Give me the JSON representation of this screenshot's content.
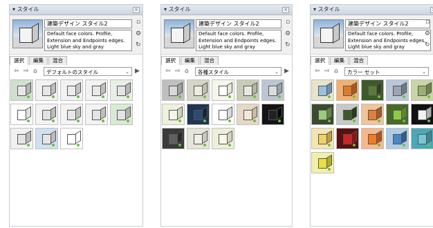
{
  "panels": [
    {
      "title": "スタイル",
      "style_name": "建築デザイン スタイル2",
      "description": "Default face colors. Profile, Extension and Endpoints edges. Light blue sky and gray",
      "tabs": [
        "選択",
        "編集",
        "混合"
      ],
      "dropdown": "デフォルトのスタイル",
      "tiles": [
        {
          "bg": "#cfe0cf",
          "face": "#e8e8e8",
          "side": "#b5b5b5"
        },
        {
          "bg": "#f2f2f2",
          "face": "#e6e6e6",
          "side": "#bdbdbd"
        },
        {
          "bg": "#f2f2f2",
          "face": "#ececec",
          "side": "#c4c4c4"
        },
        {
          "bg": "#f2f2f2",
          "face": "#e9e9e9",
          "side": "#c0c0c0"
        },
        {
          "bg": "#e8efe4",
          "face": "#e4e4e4",
          "side": "#b8b8b8"
        },
        {
          "bg": "#ffffff",
          "face": "#ffffff",
          "side": "#e0e0e0"
        },
        {
          "bg": "#f3f3f3",
          "face": "#e2e2e2",
          "side": "#bcbcbc"
        },
        {
          "bg": "#f3f3f3",
          "face": "#e8e8e8",
          "side": "#c2c2c2"
        },
        {
          "bg": "#f3f3f3",
          "face": "#e5e5e5",
          "side": "#c0c0c0"
        },
        {
          "bg": "#d9ead3",
          "face": "#e3e3e3",
          "side": "#b2b2b2"
        },
        {
          "bg": "#f1f1f1",
          "face": "#e4e4e4",
          "side": "#bdbdbd"
        },
        {
          "bg": "#cfe0f0",
          "face": "#e6e6e6",
          "side": "#bcbcbc"
        },
        {
          "bg": "#ffffff",
          "face": "#ffffff",
          "side": "#ffffff"
        }
      ]
    },
    {
      "title": "スタイル",
      "style_name": "建築デザイン スタイル2",
      "description": "Default face colors. Profile, Extension and Endpoints edges. Light blue sky and gray",
      "tabs": [
        "選択",
        "編集",
        "混合"
      ],
      "dropdown": "各種スタイル",
      "tiles": [
        {
          "bg": "#bfbfbf",
          "face": "#d8d8d8",
          "side": "#a0a0a0"
        },
        {
          "bg": "#d6d6c8",
          "face": "#ecece0",
          "side": "#c0c0b0"
        },
        {
          "bg": "#f6f6ee",
          "face": "#ffffff",
          "side": "#e6e6da"
        },
        {
          "bg": "#c9cbb9",
          "face": "#e8e8dc",
          "side": "#b4b4a4"
        },
        {
          "bg": "#bcc6d2",
          "face": "#dcdcdc",
          "side": "#9aa2aa"
        },
        {
          "bg": "#eef2dc",
          "face": "#f4f4e8",
          "side": "#d0d4bc"
        },
        {
          "bg": "#1f3552",
          "face": "#2d4a70",
          "side": "#16263c"
        },
        {
          "bg": "#ffffff",
          "face": "#ffffff",
          "side": "#d8d8d8"
        },
        {
          "bg": "#e6d8c4",
          "face": "#f2e8d8",
          "side": "#cdbaa0"
        },
        {
          "bg": "#141414",
          "face": "#222222",
          "side": "#0c0c0c"
        },
        {
          "bg": "#3b3b3b",
          "face": "#606060",
          "side": "#2a2a2a"
        },
        {
          "bg": "#e5e5d8",
          "face": "#f0f0e6",
          "side": "#c9c9bb"
        },
        {
          "bg": "#eeeeda",
          "face": "#f7f7ea",
          "side": "#d6d6c2"
        }
      ]
    },
    {
      "title": "スタイル",
      "style_name": "建築デザイン スタイル2",
      "description": "Default face colors. Profile, Extension and Endpoints edges. Light blue sky and gray",
      "tabs": [
        "選択",
        "編集",
        "混合"
      ],
      "dropdown": "カラー セット",
      "tiles": [
        {
          "bg": "#e8e4c8",
          "face": "#9bc0de",
          "side": "#6d92b2"
        },
        {
          "bg": "#f0b070",
          "face": "#e07a2c",
          "side": "#b0581a"
        },
        {
          "bg": "#3f5a2a",
          "face": "#5b7b3a",
          "side": "#2e4420"
        },
        {
          "bg": "#b8c8d8",
          "face": "#9aa6b2",
          "side": "#6e7a86"
        },
        {
          "bg": "#c9d4a8",
          "face": "#9bb070",
          "side": "#70844c"
        },
        {
          "bg": "#3c4a30",
          "face": "#9ccc7a",
          "side": "#5f8a44"
        },
        {
          "bg": "#c8c8c8",
          "face": "#3a5a2a",
          "side": "#243c18"
        },
        {
          "bg": "#f2c49a",
          "face": "#e0803a",
          "side": "#a85a22"
        },
        {
          "bg": "#4a6a2a",
          "face": "#8ccc44",
          "side": "#5e8a24"
        },
        {
          "bg": "#111111",
          "face": "#f2f2f2",
          "side": "#b0b0b0"
        },
        {
          "bg": "#f4e6b0",
          "face": "#f0d068",
          "side": "#c0a040"
        },
        {
          "bg": "#5a1010",
          "face": "#d02424",
          "side": "#8a1414"
        },
        {
          "bg": "#f4b88a",
          "face": "#f07a28",
          "side": "#b85418"
        },
        {
          "bg": "#b0cce4",
          "face": "#4a86c6",
          "side": "#2e5e94"
        },
        {
          "bg": "#4aa8b8",
          "face": "#76c8d6",
          "side": "#3a8896"
        },
        {
          "bg": "#f0f0a8",
          "face": "#e8e040",
          "side": "#b4ac24"
        }
      ]
    }
  ]
}
